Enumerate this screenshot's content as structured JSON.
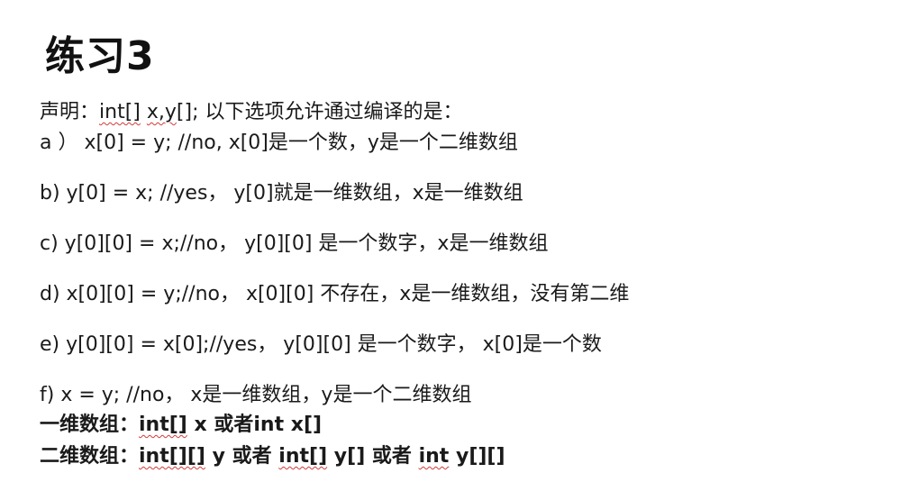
{
  "slide": {
    "title": "练习3",
    "statement": {
      "prefix": "声明：",
      "code_int": "int[]",
      "code_space": " ",
      "code_xy": "x,y",
      "code_rest": "[];  以下选项允许通过编译的是："
    },
    "options": [
      {
        "id": "a",
        "text": "a ）  x[0] = y;  //no, x[0]是一个数，y是一个二维数组"
      },
      {
        "id": "b",
        "text": "b)    y[0] = x; //yes，   y[0]就是一维数组，x是一维数组"
      },
      {
        "id": "c",
        "text": "c)    y[0][0] = x;//no，   y[0][0] 是一个数字，x是一维数组"
      },
      {
        "id": "d",
        "text": "d)    x[0][0] = y;//no，   x[0][0] 不存在，x是一维数组，没有第二维"
      },
      {
        "id": "e",
        "text": "e)    y[0][0] = x[0];//yes，   y[0][0] 是一个数字，   x[0]是一个数"
      },
      {
        "id": "f",
        "text": "f)    x = y; //no，   x是一维数组，y是一个二维数组"
      }
    ],
    "summary_1d": {
      "label": "一维数组：",
      "code_int": "int[]",
      "rest": " x  或者int x[]"
    },
    "summary_2d": {
      "label": "二维数组：",
      "code_int": "int[][]",
      "mid": " y 或者  ",
      "code_int2": "int[]",
      "mid2": " y[]  或者 ",
      "code_int3": "int",
      "rest": "  y[][]"
    }
  }
}
